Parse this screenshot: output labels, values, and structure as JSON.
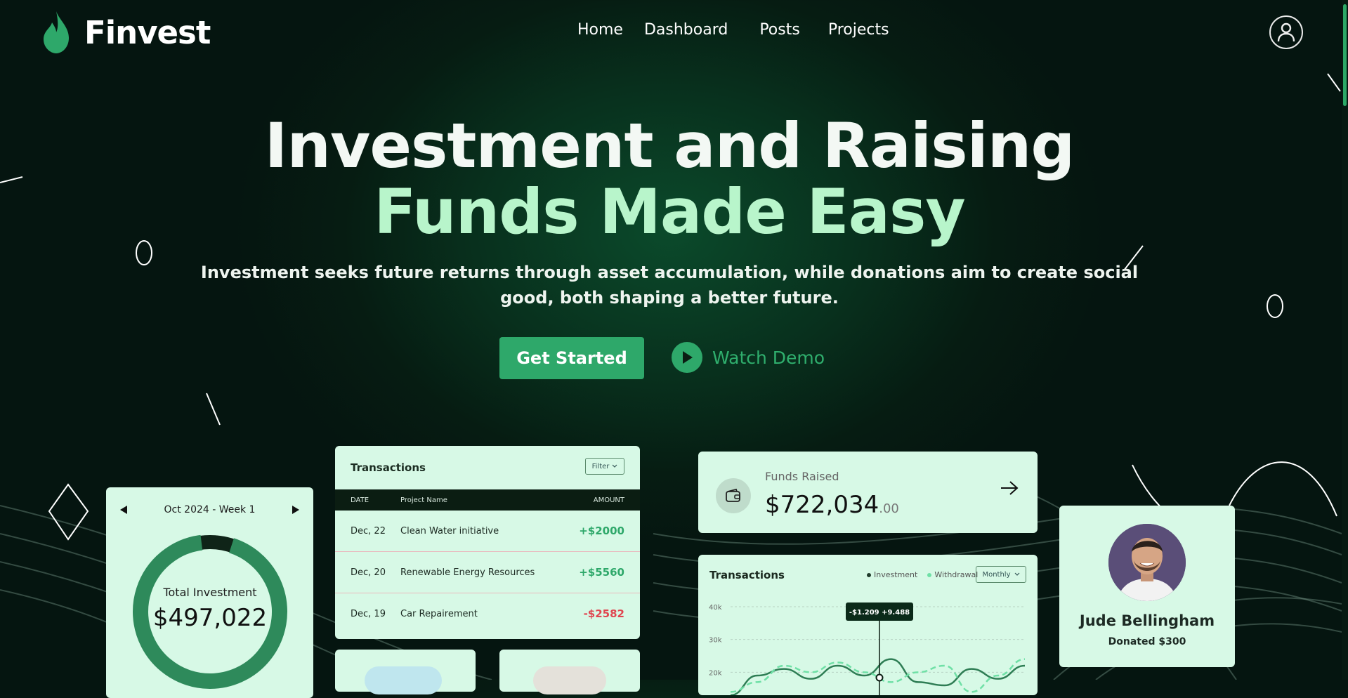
{
  "brand": {
    "name": "Finvest",
    "accent": "#2ea86a",
    "highlight": "#b8f5cb"
  },
  "nav": {
    "items": [
      "Home",
      "Dashboard",
      "Posts",
      "Projects"
    ]
  },
  "hero": {
    "title_line1": "Investment and Raising",
    "title_line2": "Funds Made Easy",
    "subtitle": "Investment seeks future returns through asset accumulation, while donations aim to create social good, both shaping a better future.",
    "cta_primary": "Get Started",
    "cta_secondary": "Watch Demo"
  },
  "week_card": {
    "period": "Oct 2024 - Week 1",
    "label": "Total Investment",
    "value": "$497,022",
    "progress": 0.93
  },
  "transactions": {
    "title": "Transactions",
    "filter": "Filter",
    "columns": [
      "DATE",
      "Project Name",
      "AMOUNT"
    ],
    "rows": [
      {
        "date": "Dec, 22",
        "name": "Clean Water initiative",
        "amount": "+$2000",
        "color": "#2ea86a"
      },
      {
        "date": "Dec, 20",
        "name": "Renewable Energy Resources",
        "amount": "+$5560",
        "color": "#2ea86a"
      },
      {
        "date": "Dec, 19",
        "name": "Car Repairement",
        "amount": "-$2582",
        "color": "#e0454f"
      }
    ]
  },
  "funds": {
    "label": "Funds Raised",
    "value": "$722,034",
    "cents": ".00"
  },
  "chart_card": {
    "title": "Transactions",
    "legend": [
      "Investment",
      "Withdrawal"
    ],
    "period": "Monthly",
    "tooltip": "-$1.209 +9.488",
    "y_ticks": [
      "40k",
      "30k",
      "20k"
    ]
  },
  "chart_data": {
    "type": "line",
    "ylim": [
      10000,
      40000
    ],
    "series": [
      {
        "name": "Investment",
        "values": [
          13000,
          19000,
          21000,
          18000,
          22000,
          19000,
          24000,
          17000,
          16000,
          21000,
          18000,
          22000
        ]
      },
      {
        "name": "Withdrawal",
        "values": [
          14000,
          17000,
          22000,
          20000,
          23000,
          20000,
          17000,
          20000,
          22000,
          14000,
          19000,
          24000
        ]
      }
    ],
    "grid": true,
    "legend_position": "top"
  },
  "donor": {
    "name": "Jude Bellingham",
    "donated": "Donated $300"
  }
}
